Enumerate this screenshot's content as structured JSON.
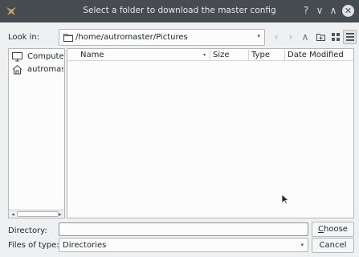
{
  "titlebar": {
    "title": "Select a folder to download the master config",
    "help_glyph": "?",
    "minimize_glyph": "∨",
    "maximize_glyph": "∧",
    "close_glyph": "✕"
  },
  "lookin": {
    "label": "Look in:",
    "path": "/home/autromaster/Pictures",
    "icon": "folder-icon"
  },
  "nav": {
    "back_glyph": "‹",
    "forward_glyph": "›",
    "up_glyph": "∧"
  },
  "sidebar": {
    "items": [
      {
        "label": "Computer",
        "icon": "computer-icon"
      },
      {
        "label": "autromaster",
        "icon": "home-icon"
      }
    ],
    "scroll_left_glyph": "◂",
    "scroll_right_glyph": "▸"
  },
  "filelist": {
    "columns": [
      "Name",
      "Size",
      "Type",
      "Date Modified"
    ],
    "sort_glyph": "▾"
  },
  "directory": {
    "label": "Directory:",
    "value": "",
    "choose_label_underlined": "C",
    "choose_label_rest": "hoose"
  },
  "filetype": {
    "label": "Files of type:",
    "value": "Directories",
    "cancel_label": "Cancel"
  },
  "dropdown_glyph": "▾"
}
